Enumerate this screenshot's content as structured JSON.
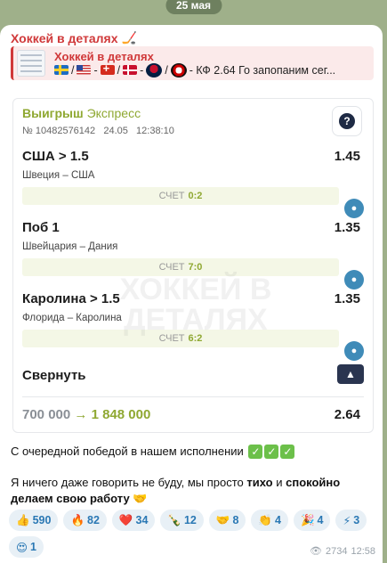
{
  "date": "25 мая",
  "channel": {
    "name": "Хоккей в деталях"
  },
  "reply": {
    "title": "Хоккей в деталях",
    "text": "- КФ 2.64  Го запопаним сег..."
  },
  "ticket": {
    "result": "Выигрыш",
    "type": "Экспресс",
    "number": "№ 10482576142",
    "date": "24.05",
    "time": "12:38:10",
    "help": "?",
    "bets": [
      {
        "title": "США > 1.5",
        "odd": "1.45",
        "match": "Швеция – США",
        "score_label": "СЧЕТ",
        "score": "0:2"
      },
      {
        "title": "Поб 1",
        "odd": "1.35",
        "match": "Швейцария – Дания",
        "score_label": "СЧЕТ",
        "score": "7:0"
      },
      {
        "title": "Каролина > 1.5",
        "odd": "1.35",
        "match": "Флорида – Каролина",
        "score_label": "СЧЕТ",
        "score": "6:2"
      }
    ],
    "collapse_label": "Свернуть",
    "stake": "700 000",
    "payout": "1 848 000",
    "total_odd": "2.64"
  },
  "watermark": "ХОККЕЙ В ДЕТАЛЯХ",
  "message": {
    "line1": "С очередной победой в нашем исполнении",
    "line2_a": "Я ничего даже говорить не буду, мы просто ",
    "line2_b": "тихо",
    "line2_c": " и ",
    "line2_d": "спокойно",
    "line3": "делаем свою работу"
  },
  "reactions": [
    {
      "emoji": "👍",
      "count": "590"
    },
    {
      "emoji": "🔥",
      "count": "82"
    },
    {
      "emoji": "❤️",
      "count": "34"
    },
    {
      "emoji": "🍾",
      "count": "12"
    },
    {
      "emoji": "🤝",
      "count": "8"
    },
    {
      "emoji": "👏",
      "count": "4"
    },
    {
      "emoji": "🎉",
      "count": "4"
    },
    {
      "emoji": "⚡",
      "count": "3"
    },
    {
      "emoji": "😍",
      "count": "1"
    }
  ],
  "footer": {
    "views": "2734",
    "time": "12:58"
  },
  "colors": {
    "accent": "#d0393a",
    "green": "#8fa832",
    "link": "#2a78b4"
  }
}
